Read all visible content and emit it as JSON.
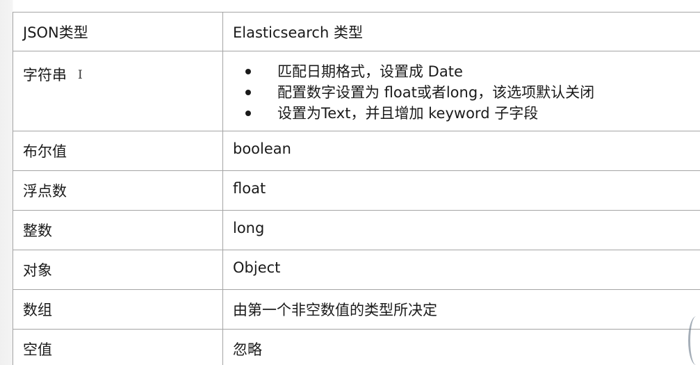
{
  "table": {
    "headers": [
      "JSON类型",
      "Elasticsearch 类型"
    ],
    "string_row": {
      "json_type": "字符串",
      "cursor_glyph": "I",
      "rules": [
        "匹配日期格式，设置成 Date",
        "配置数字设置为 float或者long，该选项默认关闭",
        "设置为Text，并且增加 keyword 子字段"
      ]
    },
    "rows": [
      {
        "json_type": "布尔值",
        "es_type": "boolean"
      },
      {
        "json_type": "浮点数",
        "es_type": "float"
      },
      {
        "json_type": "整数",
        "es_type": "long"
      },
      {
        "json_type": "对象",
        "es_type": "Object"
      },
      {
        "json_type": "数组",
        "es_type": "由第一个非空数值的类型所决定"
      },
      {
        "json_type": "空值",
        "es_type": "忽略"
      }
    ]
  }
}
